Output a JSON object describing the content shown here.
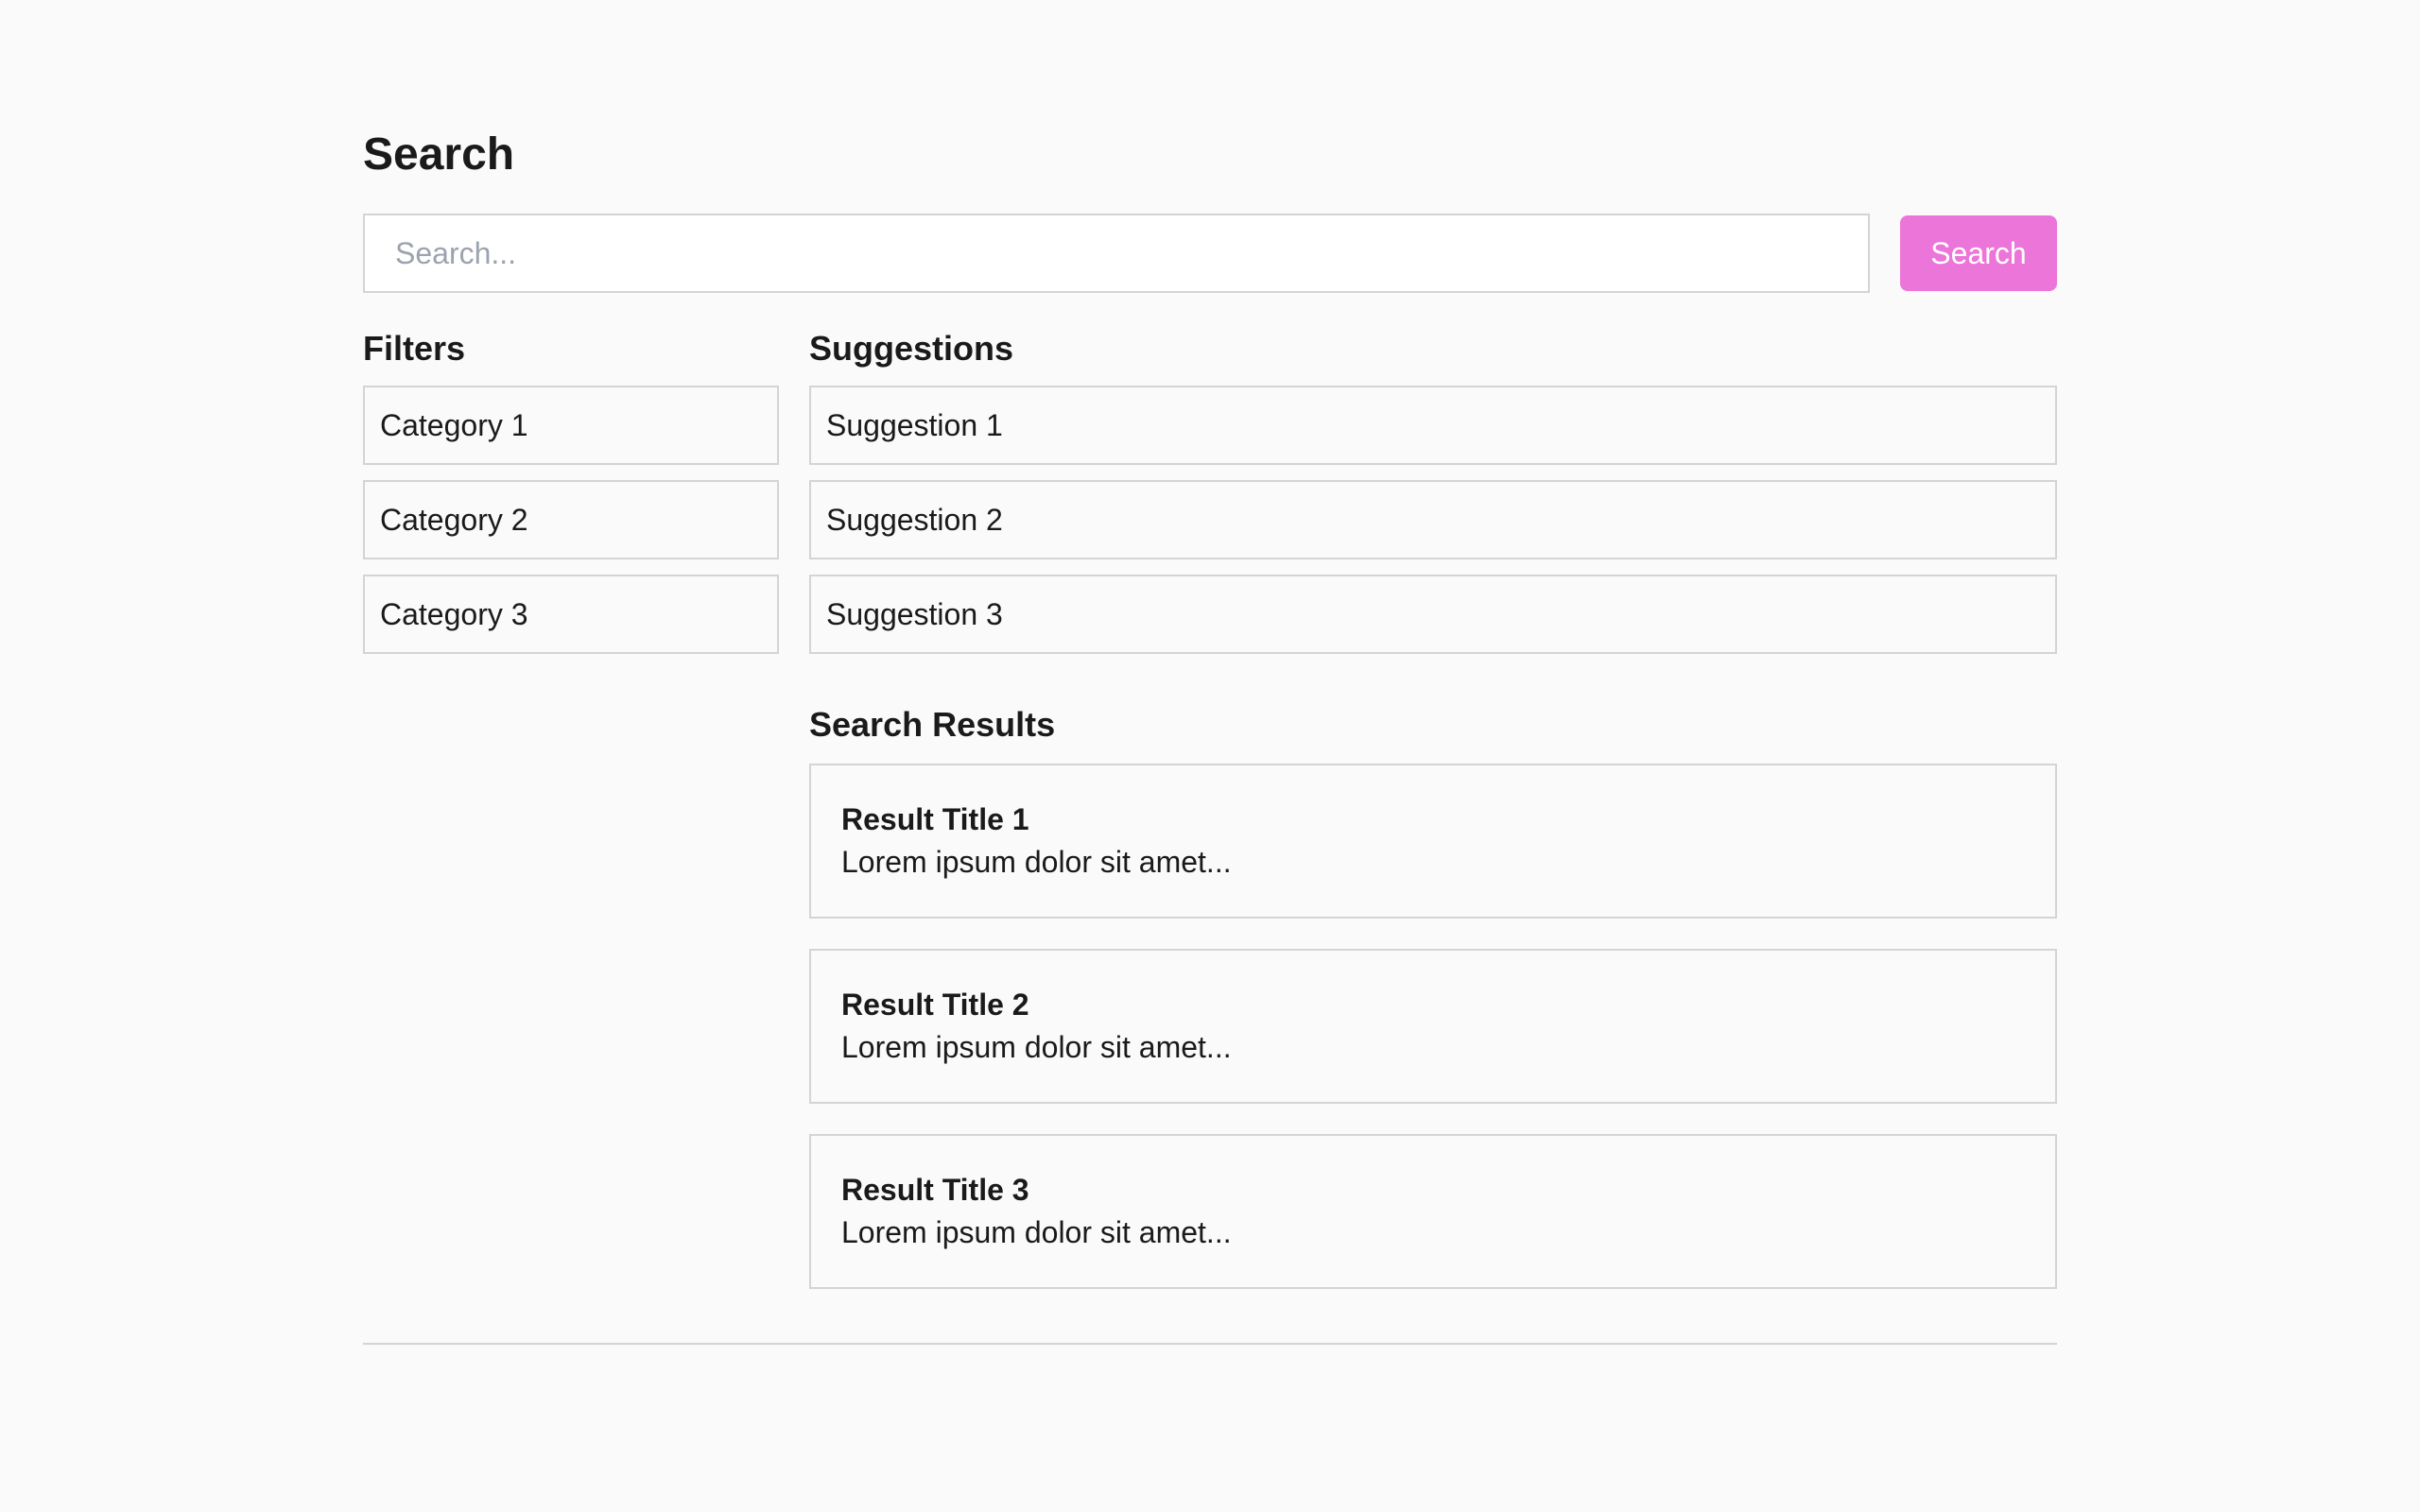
{
  "page": {
    "title": "Search"
  },
  "search": {
    "placeholder": "Search...",
    "value": "",
    "button_label": "Search",
    "button_color": "#ec75d9"
  },
  "filters": {
    "heading": "Filters",
    "items": [
      {
        "label": "Category 1"
      },
      {
        "label": "Category 2"
      },
      {
        "label": "Category 3"
      }
    ]
  },
  "suggestions": {
    "heading": "Suggestions",
    "items": [
      {
        "label": "Suggestion 1"
      },
      {
        "label": "Suggestion 2"
      },
      {
        "label": "Suggestion 3"
      }
    ]
  },
  "results": {
    "heading": "Search Results",
    "items": [
      {
        "title": "Result Title 1",
        "snippet": "Lorem ipsum dolor sit amet..."
      },
      {
        "title": "Result Title 2",
        "snippet": "Lorem ipsum dolor sit amet..."
      },
      {
        "title": "Result Title 3",
        "snippet": "Lorem ipsum dolor sit amet..."
      }
    ]
  }
}
